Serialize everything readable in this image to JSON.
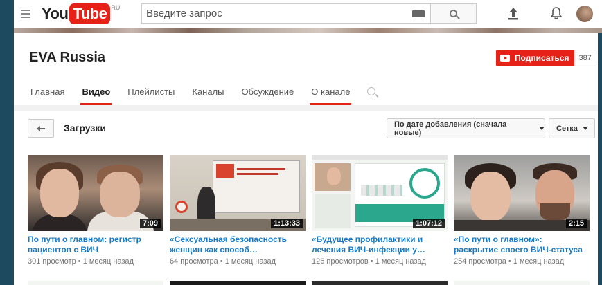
{
  "header": {
    "logo_you": "You",
    "logo_tube": "Tube",
    "logo_region": "RU",
    "search_placeholder": "Введите запрос"
  },
  "channel": {
    "name": "EVA Russia",
    "subscribe_label": "Подписаться",
    "subscriber_count": "387",
    "tabs": [
      {
        "label": "Главная",
        "active": false
      },
      {
        "label": "Видео",
        "active": true
      },
      {
        "label": "Плейлисты",
        "active": false
      },
      {
        "label": "Каналы",
        "active": false
      },
      {
        "label": "Обсуждение",
        "active": false
      },
      {
        "label": "О канале",
        "active": false
      }
    ]
  },
  "section": {
    "title": "Загрузки",
    "sort_label": "По дате добавления (сначала новые)",
    "view_label": "Сетка"
  },
  "videos": [
    {
      "title_line1": "По пути о главном: регистр",
      "title_line2": "пациентов с ВИЧ",
      "duration": "7:09",
      "views": "301 просмотр",
      "age": "1 месяц назад"
    },
    {
      "title_line1": "«Сексуальная безопасность",
      "title_line2": "женщин как способ…",
      "duration": "1:13:33",
      "views": "64 просмотра",
      "age": "1 месяц назад"
    },
    {
      "title_line1": "«Будущее профилактики и",
      "title_line2": "лечения ВИЧ-инфекции у…",
      "duration": "1:07:12",
      "views": "126 просмотров",
      "age": "1 месяц назад"
    },
    {
      "title_line1": "«По пути о главном»:",
      "title_line2": "раскрытие своего ВИЧ-статуса",
      "duration": "2:15",
      "views": "254 просмотра",
      "age": "1 месяц назад"
    }
  ],
  "meta_separator": "•",
  "colors": {
    "accent_red": "#e62117",
    "link_blue": "#167ac6",
    "page_background": "#1d4a5e"
  },
  "icons": {
    "menu": "hamburger-icon",
    "keyboard": "keyboard-icon",
    "search": "search-icon",
    "upload": "upload-icon",
    "notifications": "bell-icon",
    "back": "back-arrow-icon"
  }
}
